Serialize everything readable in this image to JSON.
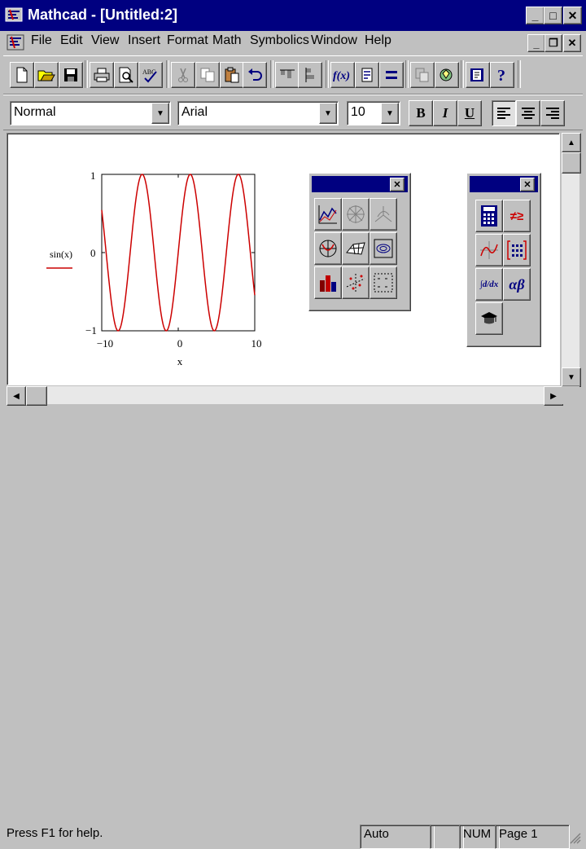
{
  "window": {
    "title": "Mathcad - [Untitled:2]",
    "minimize": "_",
    "maximize": "□",
    "close": "✕"
  },
  "menu": {
    "items": [
      "File",
      "Edit",
      "View",
      "Insert",
      "Format",
      "Math",
      "Symbolics",
      "Window",
      "Help"
    ]
  },
  "mdi_controls": {
    "minimize": "_",
    "restore": "❐",
    "close": "✕"
  },
  "toolbar": {
    "icons": [
      "new-icon",
      "open-icon",
      "save-icon",
      "print-icon",
      "print-preview-icon",
      "spell-check-icon",
      "cut-icon",
      "copy-icon",
      "paste-icon",
      "undo-icon",
      "align-across-icon",
      "align-down-icon",
      "insert-function-icon",
      "insert-unit-icon",
      "calculate-icon",
      "resource-icon",
      "component-icon",
      "quicksheets-icon",
      "help-icon"
    ]
  },
  "format_bar": {
    "style": "Normal",
    "font": "Arial",
    "size": "10",
    "bold": "B",
    "italic": "I",
    "underline": "U"
  },
  "graph": {
    "legend": "sin(x)",
    "xlabel": "x",
    "y_max_label": "1",
    "y_mid_label": "0",
    "y_min_label": "−1",
    "x_min_label": "−10",
    "x_mid_label": "0",
    "x_max_label": "10",
    "line_color": "#cc0000"
  },
  "chart_data": {
    "type": "line",
    "series": [
      {
        "name": "sin(x)",
        "function": "sin(x)"
      }
    ],
    "xlim": [
      -10,
      10
    ],
    "ylim": [
      -1,
      1
    ],
    "xlabel": "x",
    "ylabel": "sin(x)",
    "x_ticks": [
      -10,
      0,
      10
    ],
    "y_ticks": [
      -1,
      0,
      1
    ]
  },
  "graph_palette": {
    "icons": [
      "xy-plot-icon",
      "polar-plot-icon",
      "surface-plot-icon",
      "polar-chart-icon",
      "3d-surface-icon",
      "contour-plot-icon",
      "bar-plot-icon",
      "scatter-3d-icon",
      "vector-field-icon"
    ]
  },
  "math_palette": {
    "icons": [
      "calculator-icon",
      "evaluation-icon",
      "graph-icon",
      "matrix-icon",
      "calculus-icon",
      "greek-icon",
      "symbolic-icon"
    ],
    "evaluation_glyph": "≠≥",
    "calculus_glyph": "∫d/dx",
    "greek_glyph": "αβ"
  },
  "status": {
    "help": "Press F1 for help.",
    "mode": "Auto",
    "num": "NUM",
    "page": "Page 1"
  }
}
